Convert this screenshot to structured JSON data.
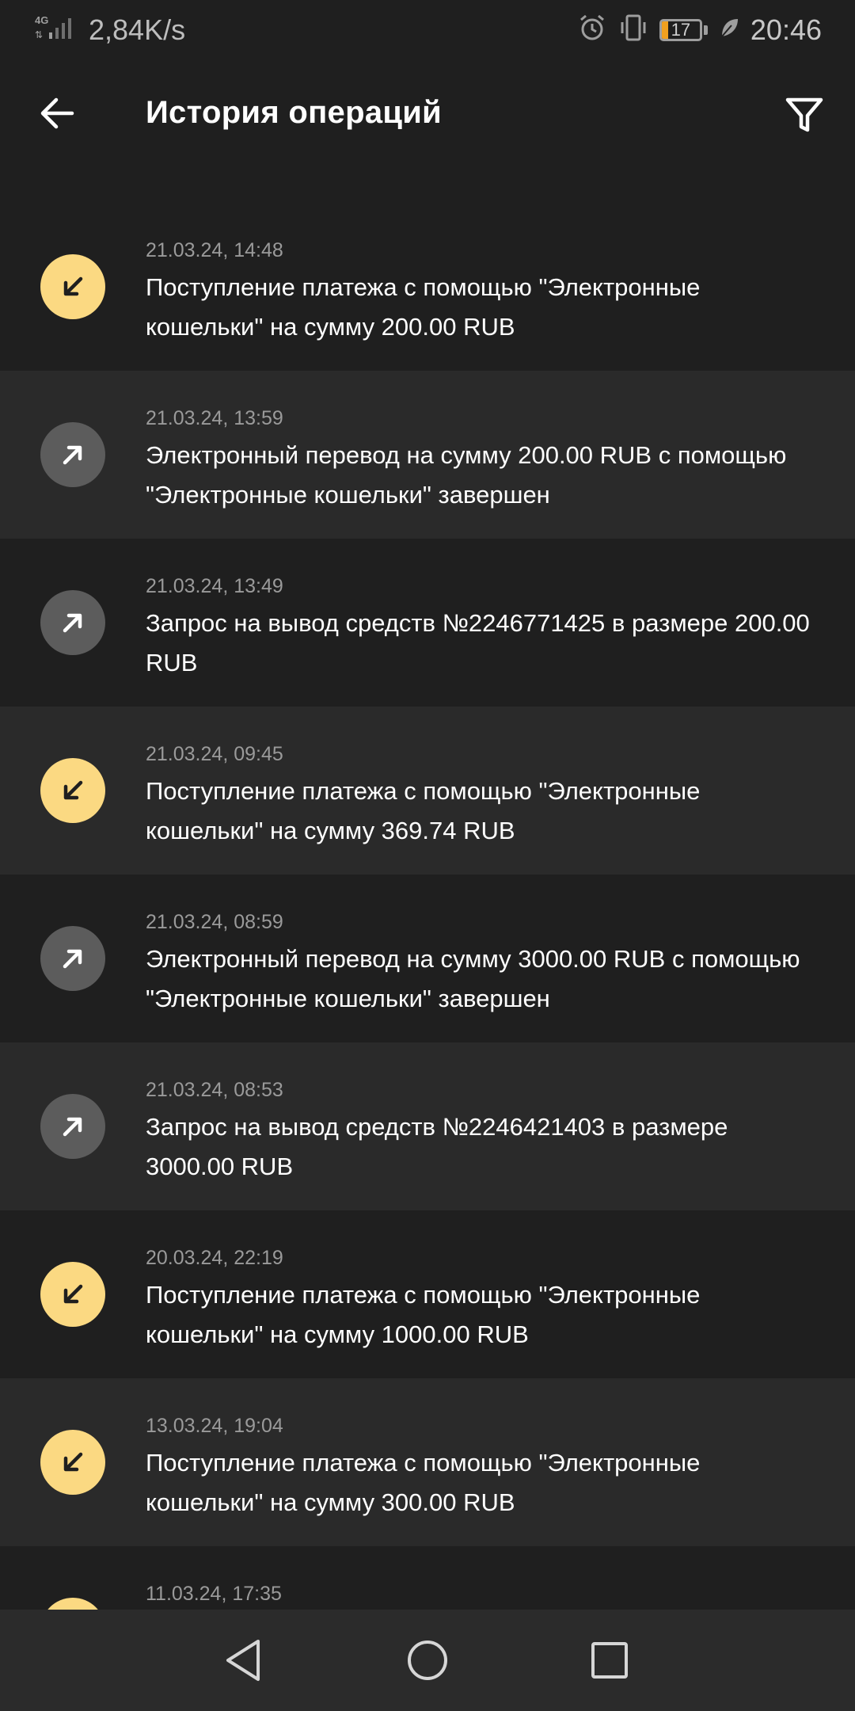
{
  "status_bar": {
    "network_type": "4G",
    "net_speed": "2,84K/s",
    "battery_level": "17",
    "battery_fraction": 0.17,
    "time": "20:46"
  },
  "header": {
    "title": "История операций",
    "back_icon": "arrow-left-icon",
    "filter_icon": "filter-icon"
  },
  "colors": {
    "incoming_icon_bg": "#fbd982",
    "outgoing_icon_bg": "#5c5c5c",
    "battery_fill": "#f0a020"
  },
  "operations": [
    {
      "direction": "in",
      "date": "21.03.24, 14:48",
      "text": "Поступление платежа с помощью \"Электронные кошельки\" на сумму 200.00 RUB"
    },
    {
      "direction": "out",
      "date": "21.03.24, 13:59",
      "text": "Электронный перевод на сумму 200.00 RUB с помощью \"Электронные кошельки\" завершен"
    },
    {
      "direction": "out",
      "date": "21.03.24, 13:49",
      "text": "Запрос на вывод средств №2246771425 в размере 200.00 RUB"
    },
    {
      "direction": "in",
      "date": "21.03.24, 09:45",
      "text": "Поступление платежа с помощью \"Электронные кошельки\" на сумму 369.74 RUB"
    },
    {
      "direction": "out",
      "date": "21.03.24, 08:59",
      "text": "Электронный перевод на сумму 3000.00 RUB с помощью \"Электронные кошельки\" завершен"
    },
    {
      "direction": "out",
      "date": "21.03.24, 08:53",
      "text": "Запрос на вывод средств №2246421403 в размере 3000.00 RUB"
    },
    {
      "direction": "in",
      "date": "20.03.24, 22:19",
      "text": "Поступление платежа с помощью \"Электронные кошельки\" на сумму 1000.00 RUB"
    },
    {
      "direction": "in",
      "date": "13.03.24, 19:04",
      "text": "Поступление платежа с помощью \"Электронные кошельки\" на сумму 300.00 RUB"
    },
    {
      "direction": "in",
      "date": "11.03.24, 17:35",
      "text": ""
    }
  ],
  "nav_bar": {
    "back": "triangle-back-icon",
    "home": "circle-home-icon",
    "recents": "square-recents-icon"
  }
}
